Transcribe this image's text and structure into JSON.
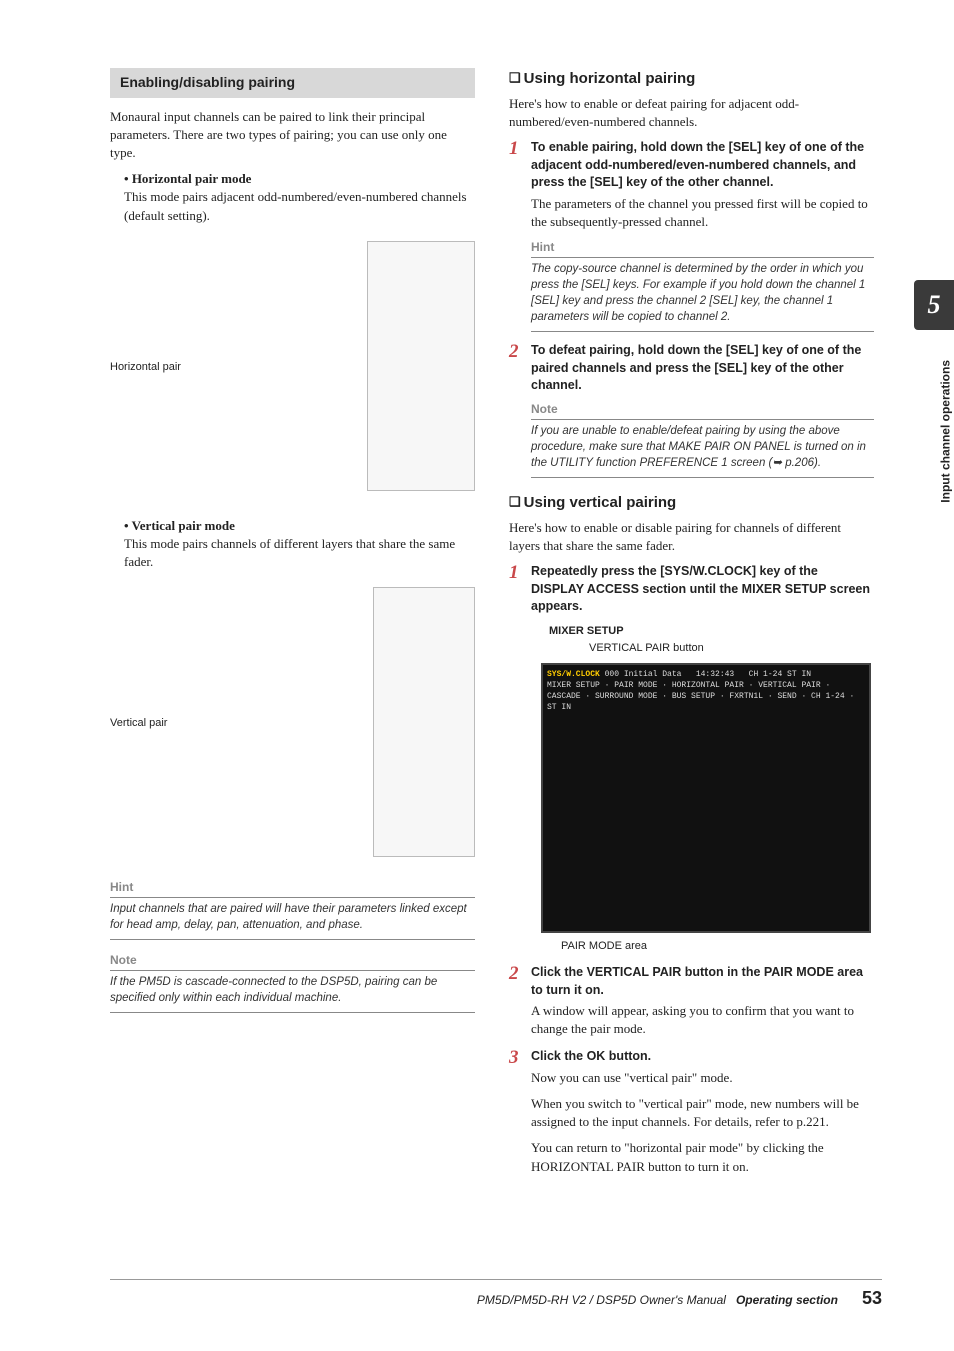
{
  "chapter_number": "5",
  "side_label": "Input channel operations",
  "left": {
    "section_title": "Enabling/disabling pairing",
    "intro": "Monaural input channels can be paired to link their principal parameters. There are two types of pairing; you can use only one type.",
    "hpair_title": "Horizontal pair mode",
    "hpair_body": "This mode pairs adjacent odd-numbered/even-numbered channels (default setting).",
    "hpair_fig_label": "Horizontal pair",
    "vpair_title": "Vertical pair mode",
    "vpair_body": "This mode pairs channels of different layers that share the same fader.",
    "vpair_fig_label": "Vertical pair",
    "hint_label": "Hint",
    "hint_body": "Input channels that are paired will have their parameters linked except for head amp, delay, pan, attenuation, and phase.",
    "note_label": "Note",
    "note_body": "If the PM5D is cascade-connected to the DSP5D, pairing can be specified only within each individual machine."
  },
  "right": {
    "h2a": "Using horizontal pairing",
    "intro_a": "Here's how to enable or defeat pairing for adjacent odd-numbered/even-numbered channels.",
    "step_a1_bold": "To enable pairing, hold down the [SEL] key of one of the adjacent odd-numbered/even-numbered channels, and press the [SEL] key of the other channel.",
    "step_a1_body": "The parameters of the channel you pressed first will be copied to the subsequently-pressed channel.",
    "hint_label": "Hint",
    "hint_body_a": "The copy-source channel is determined by the order in which you press the [SEL] keys. For example if you hold down the channel 1 [SEL] key and press the channel 2 [SEL] key, the channel 1 parameters will be copied to channel 2.",
    "step_a2_bold": "To defeat pairing, hold down the [SEL] key of one of the paired channels and press the [SEL] key of the other channel.",
    "note_label": "Note",
    "note_body_a": "If you are unable to enable/defeat pairing by using the above procedure, make sure that MAKE PAIR ON PANEL is turned on in the UTILITY function PREFERENCE 1 screen (➥ p.206).",
    "h2b": "Using vertical pairing",
    "intro_b": "Here's how to enable or disable pairing for channels of different layers that share the same fader.",
    "step_b1_bold": "Repeatedly press the [SYS/W.CLOCK] key of the DISPLAY ACCESS section until the MIXER SETUP screen appears.",
    "mixer_setup_label": "MIXER SETUP",
    "vpair_button_label": "VERTICAL PAIR button",
    "pairmode_area_label": "PAIR MODE area",
    "step_b2_bold": "Click the VERTICAL PAIR button in the PAIR MODE area to turn it on.",
    "step_b2_body": "A window will appear, asking you to confirm that you want to change the pair mode.",
    "step_b3_bold": "Click the OK button.",
    "step_b3_body1": "Now you can use \"vertical pair\" mode.",
    "step_b3_body2": "When you switch to \"vertical pair\" mode, new numbers will be assigned to the input channels. For details, refer to p.221.",
    "step_b3_body3": "You can return to \"horizontal pair mode\" by clicking the HORIZONTAL PAIR button to turn it on."
  },
  "footer": {
    "model": "PM5D/PM5D-RH V2 / DSP5D Owner's Manual",
    "section": "Operating section",
    "page": "53"
  }
}
